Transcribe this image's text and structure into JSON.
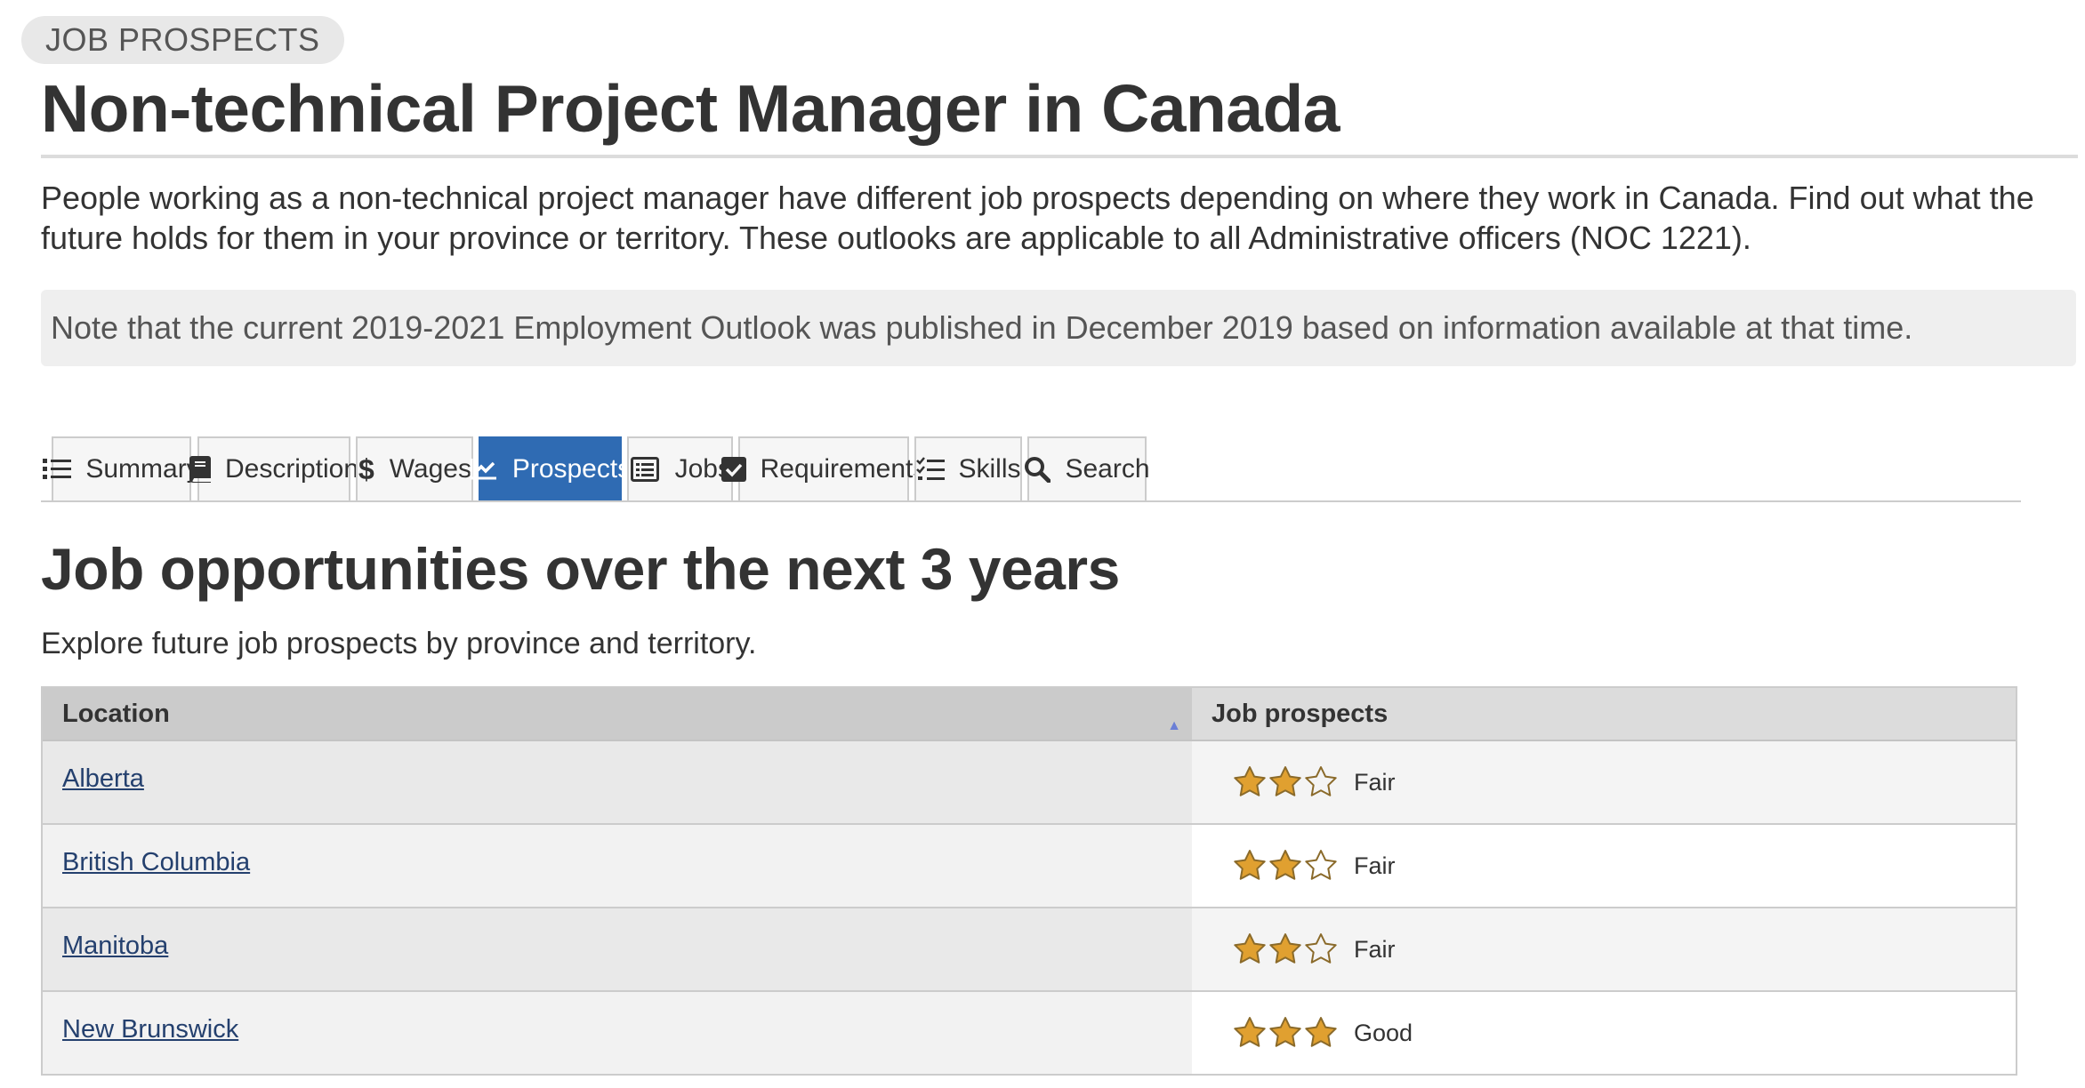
{
  "header": {
    "kicker": "JOB PROSPECTS",
    "title": "Non-technical Project Manager in Canada"
  },
  "intro": "People working as a non-technical project manager have different job prospects depending on where they work in Canada. Find out what the future holds for them in your province or territory. These outlooks are applicable to all Administrative officers (NOC 1221).",
  "note": "Note that the current 2019-2021 Employment Outlook was published in December 2019 based on information available at that time.",
  "tabs": [
    {
      "label": "Summary",
      "icon": "list-icon",
      "active": false
    },
    {
      "label": "Description",
      "icon": "book-icon",
      "active": false
    },
    {
      "label": "Wages",
      "icon": "dollar-icon",
      "active": false
    },
    {
      "label": "Prospects",
      "icon": "line-chart-icon",
      "active": true
    },
    {
      "label": "Jobs",
      "icon": "list-alt-icon",
      "active": false
    },
    {
      "label": "Requirements",
      "icon": "checkbox-icon",
      "active": false
    },
    {
      "label": "Skills",
      "icon": "checklist-icon",
      "active": false
    },
    {
      "label": "Search",
      "icon": "search-icon",
      "active": false
    }
  ],
  "section": {
    "title": "Job opportunities over the next 3 years",
    "subtitle": "Explore future job prospects by province and territory."
  },
  "table": {
    "headers": {
      "location": "Location",
      "prospects": "Job prospects"
    },
    "sort_icon": "▲",
    "rows": [
      {
        "location": "Alberta",
        "stars": 2,
        "max_stars": 3,
        "rating": "Fair"
      },
      {
        "location": "British Columbia",
        "stars": 2,
        "max_stars": 3,
        "rating": "Fair"
      },
      {
        "location": "Manitoba",
        "stars": 2,
        "max_stars": 3,
        "rating": "Fair"
      },
      {
        "location": "New Brunswick",
        "stars": 3,
        "max_stars": 3,
        "rating": "Good"
      }
    ]
  },
  "colors": {
    "accent": "#2f6bb3",
    "link": "#24406e",
    "star_fill": "#e0a030",
    "star_outline": "#8a6a2a"
  }
}
